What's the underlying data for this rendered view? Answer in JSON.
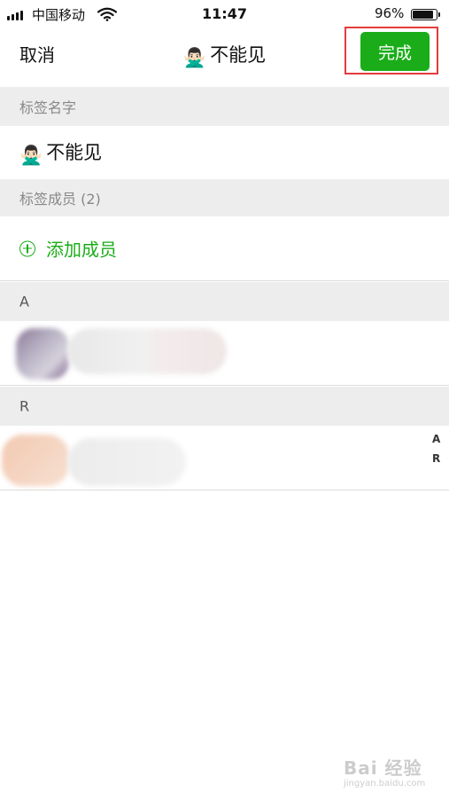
{
  "status_bar": {
    "carrier": "中国移动",
    "time": "11:47",
    "battery_pct": "96%"
  },
  "nav": {
    "cancel_label": "取消",
    "title_emoji": "🙅🏻‍♂️",
    "title": "不能见",
    "done_label": "完成"
  },
  "tag_name_section": {
    "header": "标签名字",
    "value_emoji": "🙅🏻‍♂️",
    "value": "不能见"
  },
  "members_section": {
    "header": "标签成员 (2)",
    "add_label": "添加成员"
  },
  "groups": [
    {
      "letter": "A"
    },
    {
      "letter": "R"
    }
  ],
  "index_bar": [
    "A",
    "R"
  ],
  "watermark": {
    "logo": "Bai 经验",
    "url": "jingyan.baidu.com"
  },
  "colors": {
    "accent_green": "#1aad19",
    "highlight_red": "#e53b3b",
    "section_bg": "#ededed"
  }
}
